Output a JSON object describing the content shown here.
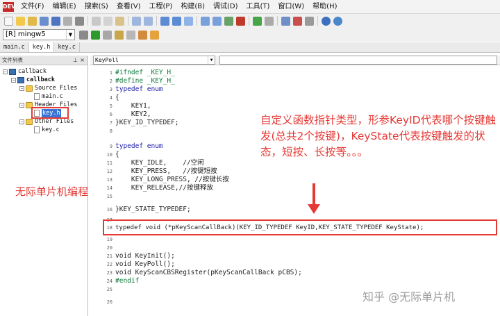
{
  "menubar": {
    "app_icon_label": "DEV",
    "items": [
      {
        "label": "文件(F)"
      },
      {
        "label": "编辑(E)"
      },
      {
        "label": "搜索(S)"
      },
      {
        "label": "查看(V)"
      },
      {
        "label": "工程(P)"
      },
      {
        "label": "构建(B)"
      },
      {
        "label": "调试(D)"
      },
      {
        "label": "工具(T)"
      },
      {
        "label": "窗口(W)"
      },
      {
        "label": "帮助(H)"
      }
    ]
  },
  "toolbar": {
    "compiler": "[R] mingw5",
    "dropdown_arrow": "▼"
  },
  "file_tabs": [
    "main.c",
    "key.h",
    "key.c"
  ],
  "project_panel": {
    "title": "文件列表",
    "pin": "⊥",
    "close": "×",
    "tree": {
      "root": "callback",
      "project": "callback",
      "source_folder": "Source Files",
      "source_file": "main.c",
      "header_folder": "Header Files",
      "header_file": "key.h",
      "other_folder": "Other Files",
      "other_file": "key.c"
    }
  },
  "editor_header": {
    "function_selector": "KeyPoll",
    "arrow": "▼"
  },
  "code_lines": [
    {
      "n": "1",
      "t": "#ifndef _KEY_H_"
    },
    {
      "n": "2",
      "t": "#define _KEY_H_"
    },
    {
      "n": "3",
      "t": "typedef enum"
    },
    {
      "n": "4",
      "t": "{"
    },
    {
      "n": "5",
      "t": "    KEY1,"
    },
    {
      "n": "6",
      "t": "    KEY2,"
    },
    {
      "n": "7",
      "t": "}KEY_ID_TYPEDEF;"
    },
    {
      "n": "8",
      "t": ""
    },
    {
      "n": "9",
      "t": "typedef enum"
    },
    {
      "n": "10",
      "t": "{"
    },
    {
      "n": "11",
      "t": "    KEY_IDLE,    //空闲"
    },
    {
      "n": "12",
      "t": "    KEY_PRESS,   //按键短按"
    },
    {
      "n": "13",
      "t": "    KEY_LONG_PRESS, //按键长按"
    },
    {
      "n": "14",
      "t": "    KEY_RELEASE,//按键释放"
    },
    {
      "n": "15",
      "t": ""
    },
    {
      "n": "16",
      "t": "}KEY_STATE_TYPEDEF;"
    },
    {
      "n": "17",
      "t": ""
    },
    {
      "n": "18",
      "t": "typedef void (*pKeyScanCallBack)(KEY_ID_TYPEDEF KeyID,KEY_STATE_TYPEDEF KeyState);"
    },
    {
      "n": "19",
      "t": ""
    },
    {
      "n": "20",
      "t": ""
    },
    {
      "n": "21",
      "t": "void KeyInit();"
    },
    {
      "n": "22",
      "t": "void KeyPoll();"
    },
    {
      "n": "23",
      "t": "void KeyScanCBSRegister(pKeyScanCallBack pCBS);"
    },
    {
      "n": "24",
      "t": "#endif"
    },
    {
      "n": "25",
      "t": ""
    },
    {
      "n": "26",
      "t": ""
    }
  ],
  "annotations": {
    "left_note": "无际单片机编程",
    "callout": "自定义函数指针类型，形参KeyID代表哪个按键触发(总共2个按键)，KeyState代表按键触发的状态，短按、长按等。。。",
    "arrow_color": "#e53935",
    "watermark": "知乎 @无际单片机"
  },
  "colors": {
    "annotation_red": "#e53935",
    "keyword_blue": "#1c1ca8",
    "comment_green": "#2e8b2e",
    "selection_blue": "#3875d7"
  }
}
